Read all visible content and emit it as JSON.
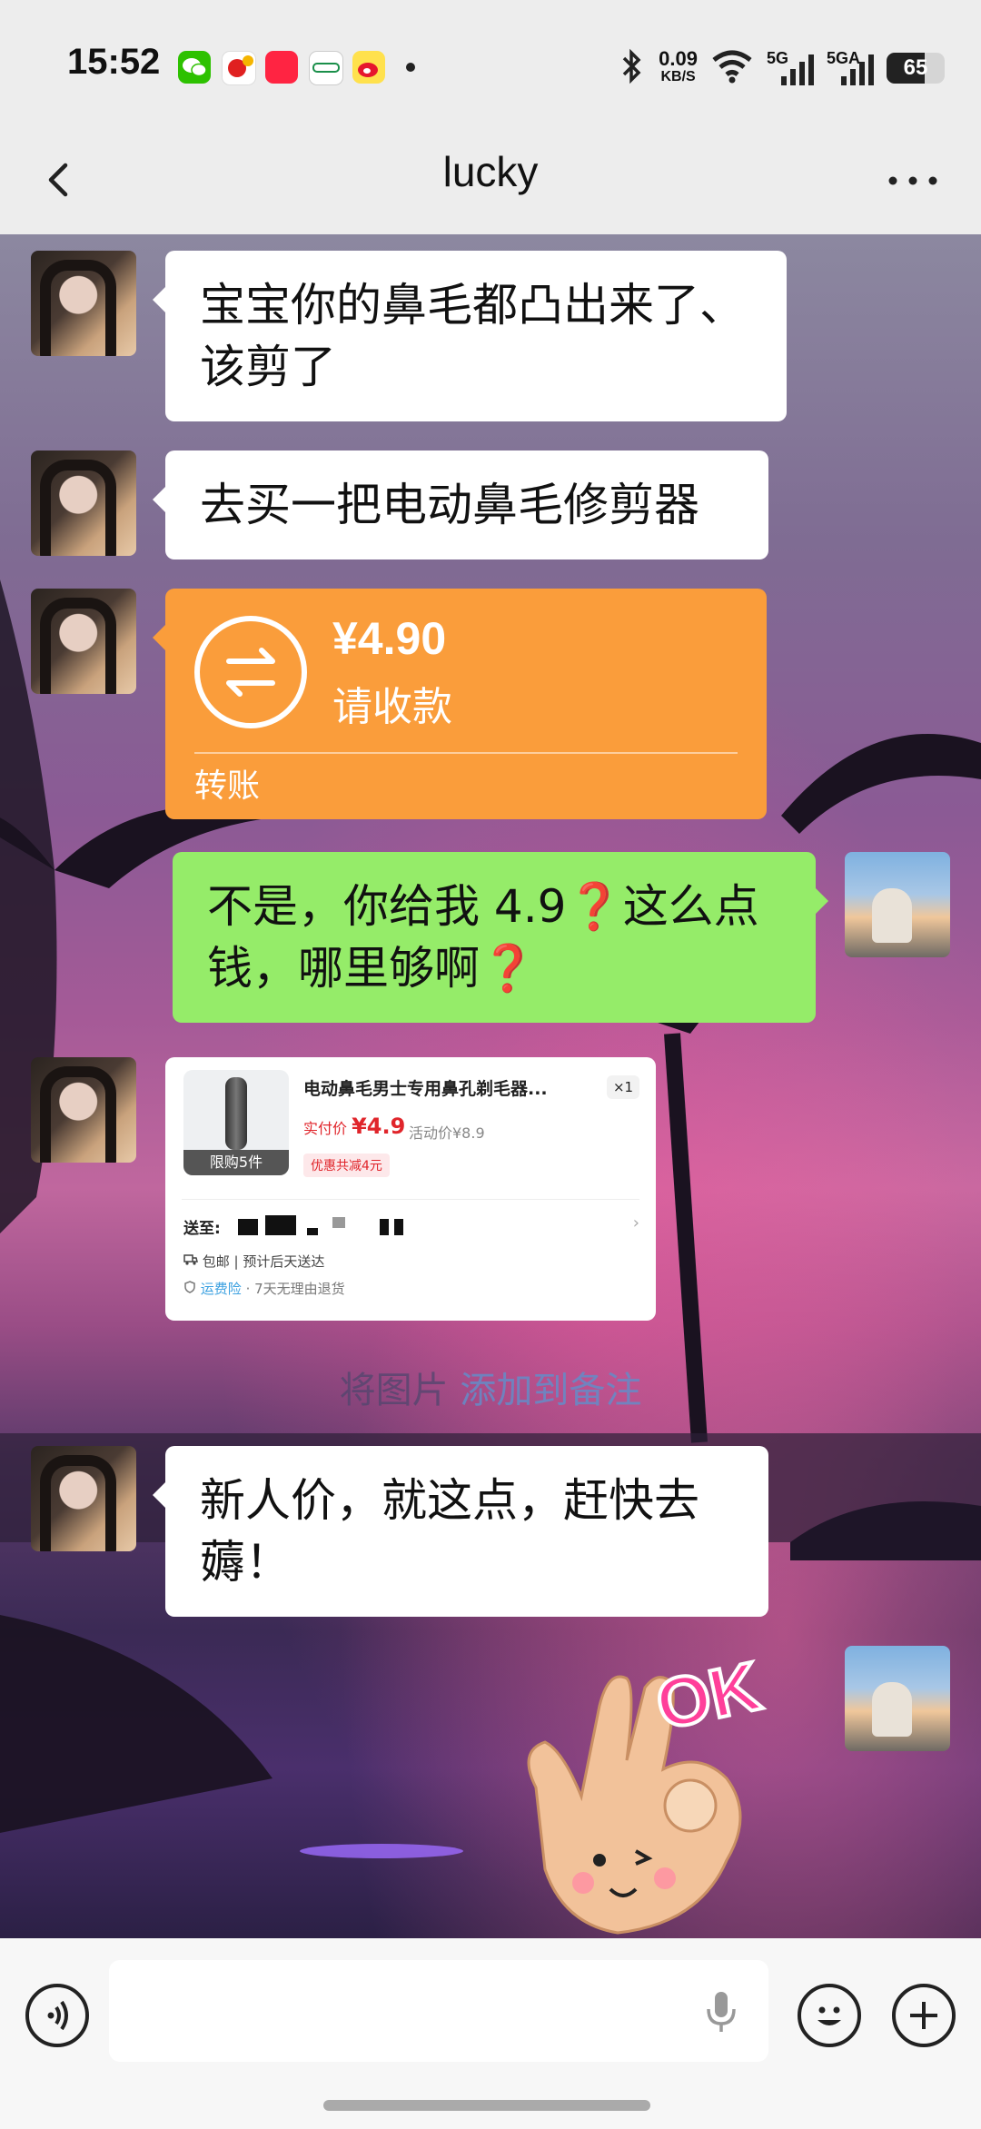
{
  "status_bar": {
    "time": "15:52",
    "net_speed_value": "0.09",
    "net_speed_unit": "KB/S",
    "sim1_label": "5G",
    "sim2_label": "5GA",
    "battery_percent": 65,
    "battery_text": "65",
    "notification_icons": [
      "wechat-icon",
      "app-icon",
      "xiaohongshu-icon",
      "oppo-icon",
      "weibo-icon"
    ]
  },
  "nav": {
    "title": "lucky",
    "back_icon": "chevron-left-icon",
    "more_icon": "more-dots-icon"
  },
  "messages": [
    {
      "sender": "her",
      "type": "text",
      "text": "宝宝你的鼻毛都凸出来了、该剪了"
    },
    {
      "sender": "her",
      "type": "text",
      "text": "去买一把电动鼻毛修剪器"
    },
    {
      "sender": "her",
      "type": "transfer",
      "amount": "¥4.90",
      "status": "请收款",
      "label": "转账"
    },
    {
      "sender": "me",
      "type": "text",
      "text_a": "不是，你给我 4.9",
      "q1": "❓",
      "text_b": "这么点钱，哪里够啊",
      "q2": "❓"
    },
    {
      "sender": "her",
      "type": "product",
      "badge": "限购5件",
      "name": "电动鼻毛男士专用鼻孔剃毛器...",
      "qty": "×1",
      "price_label": "实付价",
      "price_value": "¥4.9",
      "orig_price": "活动价¥8.9",
      "coupon": "优惠共减4元",
      "ship_to_label": "送至:",
      "free_ship": "包邮 | 预计后天送达",
      "insurance_label": "运费险",
      "insurance_text": "· 7天无理由退货"
    },
    {
      "sender": "system",
      "type": "hint",
      "text_a": "将图片 ",
      "text_b": "添加到备注"
    },
    {
      "sender": "her",
      "type": "text",
      "text": "新人价，就这点，赶快去薅！"
    },
    {
      "sender": "me",
      "type": "sticker",
      "sticker_text": "OK"
    }
  ],
  "input_bar": {
    "voice_icon": "voice-icon",
    "mic_icon": "microphone-icon",
    "emoji_icon": "emoji-icon",
    "plus_icon": "plus-icon"
  },
  "colors": {
    "green_bubble": "#95ec69",
    "transfer_orange": "#fa9d3b",
    "price_red": "#e0252b"
  }
}
